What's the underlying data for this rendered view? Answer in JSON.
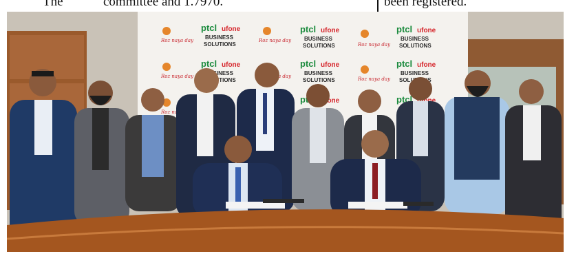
{
  "newspaper": {
    "left_fragment": "The",
    "middle_fragment": "committee  and 1.7970.",
    "right_fragment": "been registered."
  },
  "photo": {
    "backdrop_logo": {
      "ptcl": "ptcl",
      "ufone": "ufone",
      "business": "BUSINESS",
      "solutions": "SOLUTIONS",
      "tagline": "Roz naya day"
    },
    "colors": {
      "wall": "#c9c2b7",
      "wood_panel": "#9a5a2c",
      "table": "#a4561f",
      "backdrop": "#f4f2ee",
      "ptcl_green": "#1c8b3e",
      "ufone_red": "#d6262c",
      "suit_navy": "#1f2a44",
      "suit_grey": "#5d5f66"
    }
  }
}
